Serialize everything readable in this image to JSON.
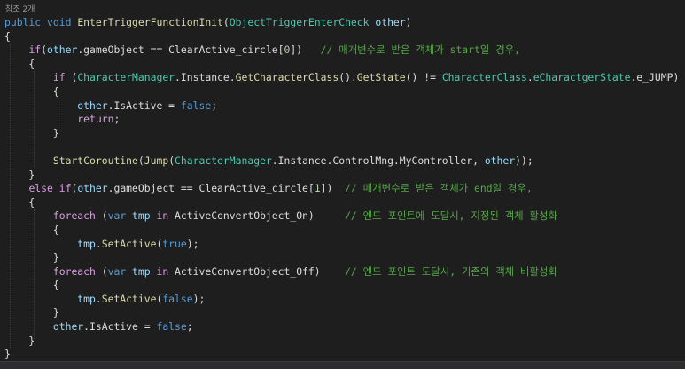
{
  "editor": {
    "reference_hint": "참조 2개",
    "colors": {
      "background": "#1e1e1e",
      "keyword": "#569cd6",
      "control": "#d8a0df",
      "type": "#4ec9b0",
      "method": "#dcdcaa",
      "variable": "#9cdcfe",
      "comment": "#57a64a",
      "number": "#b5cea8",
      "plain": "#dcdcdc"
    }
  },
  "lines": [
    [
      [
        "kw",
        "public"
      ],
      [
        "pl",
        " "
      ],
      [
        "kw",
        "void"
      ],
      [
        "pl",
        " "
      ],
      [
        "fn",
        "EnterTriggerFunctionInit"
      ],
      [
        "pl",
        "("
      ],
      [
        "cls",
        "ObjectTriggerEnterCheck"
      ],
      [
        "pl",
        " "
      ],
      [
        "var",
        "other"
      ],
      [
        "pl",
        ")"
      ]
    ],
    [
      [
        "pl",
        "{"
      ]
    ],
    [
      [
        "pl",
        "    "
      ],
      [
        "ctl",
        "if"
      ],
      [
        "pl",
        "("
      ],
      [
        "var",
        "other"
      ],
      [
        "pl",
        ".gameObject == ClearActive_circle["
      ],
      [
        "num",
        "0"
      ],
      [
        "pl",
        "])   "
      ],
      [
        "cm",
        "// 매개변수로 받은 객체가 start일 경우,"
      ]
    ],
    [
      [
        "pl",
        "    {"
      ]
    ],
    [
      [
        "pl",
        "        "
      ],
      [
        "ctl",
        "if"
      ],
      [
        "pl",
        " ("
      ],
      [
        "cls",
        "CharacterManager"
      ],
      [
        "pl",
        ".Instance."
      ],
      [
        "fn",
        "GetCharacterClass"
      ],
      [
        "pl",
        "()."
      ],
      [
        "fn",
        "GetState"
      ],
      [
        "pl",
        "() != "
      ],
      [
        "cls",
        "CharacterClass"
      ],
      [
        "pl",
        "."
      ],
      [
        "cls",
        "eCharactgerState"
      ],
      [
        "pl",
        ".e_JUMP)"
      ]
    ],
    [
      [
        "pl",
        "        {"
      ]
    ],
    [
      [
        "pl",
        "            "
      ],
      [
        "var",
        "other"
      ],
      [
        "pl",
        ".IsActive = "
      ],
      [
        "kw",
        "false"
      ],
      [
        "pl",
        ";"
      ]
    ],
    [
      [
        "pl",
        "            "
      ],
      [
        "ctl",
        "return"
      ],
      [
        "pl",
        ";"
      ]
    ],
    [
      [
        "pl",
        "        }"
      ]
    ],
    [
      [
        "pl",
        ""
      ]
    ],
    [
      [
        "pl",
        "        "
      ],
      [
        "fn",
        "StartCoroutine"
      ],
      [
        "pl",
        "("
      ],
      [
        "fn",
        "Jump"
      ],
      [
        "pl",
        "("
      ],
      [
        "cls",
        "CharacterManager"
      ],
      [
        "pl",
        ".Instance.ControlMng.MyController, "
      ],
      [
        "var",
        "other"
      ],
      [
        "pl",
        "));"
      ]
    ],
    [
      [
        "pl",
        "    }"
      ]
    ],
    [
      [
        "pl",
        "    "
      ],
      [
        "ctl",
        "else"
      ],
      [
        "pl",
        " "
      ],
      [
        "ctl",
        "if"
      ],
      [
        "pl",
        "("
      ],
      [
        "var",
        "other"
      ],
      [
        "pl",
        ".gameObject == ClearActive_circle["
      ],
      [
        "num",
        "1"
      ],
      [
        "pl",
        "])  "
      ],
      [
        "cm",
        "// 매개변수로 받은 객체가 end일 경우,"
      ]
    ],
    [
      [
        "pl",
        "    {"
      ]
    ],
    [
      [
        "pl",
        "        "
      ],
      [
        "ctl",
        "foreach"
      ],
      [
        "pl",
        " ("
      ],
      [
        "kw",
        "var"
      ],
      [
        "pl",
        " "
      ],
      [
        "var",
        "tmp"
      ],
      [
        "pl",
        " "
      ],
      [
        "ctl",
        "in"
      ],
      [
        "pl",
        " ActiveConvertObject_On)     "
      ],
      [
        "cm",
        "// 엔드 포인트에 도달시, 지정된 객체 활성화"
      ]
    ],
    [
      [
        "pl",
        "        {"
      ]
    ],
    [
      [
        "pl",
        "            "
      ],
      [
        "var",
        "tmp"
      ],
      [
        "pl",
        "."
      ],
      [
        "fn",
        "SetActive"
      ],
      [
        "pl",
        "("
      ],
      [
        "kw",
        "true"
      ],
      [
        "pl",
        ");"
      ]
    ],
    [
      [
        "pl",
        "        }"
      ]
    ],
    [
      [
        "pl",
        "        "
      ],
      [
        "ctl",
        "foreach"
      ],
      [
        "pl",
        " ("
      ],
      [
        "kw",
        "var"
      ],
      [
        "pl",
        " "
      ],
      [
        "var",
        "tmp"
      ],
      [
        "pl",
        " "
      ],
      [
        "ctl",
        "in"
      ],
      [
        "pl",
        " ActiveConvertObject_Off)    "
      ],
      [
        "cm",
        "// 엔드 포인트 도달시, 기존의 객체 비활성화"
      ]
    ],
    [
      [
        "pl",
        "        {"
      ]
    ],
    [
      [
        "pl",
        "            "
      ],
      [
        "var",
        "tmp"
      ],
      [
        "pl",
        "."
      ],
      [
        "fn",
        "SetActive"
      ],
      [
        "pl",
        "("
      ],
      [
        "kw",
        "false"
      ],
      [
        "pl",
        ");"
      ]
    ],
    [
      [
        "pl",
        "        }"
      ]
    ],
    [
      [
        "pl",
        "        "
      ],
      [
        "var",
        "other"
      ],
      [
        "pl",
        ".IsActive = "
      ],
      [
        "kw",
        "false"
      ],
      [
        "pl",
        ";"
      ]
    ],
    [
      [
        "pl",
        "    }"
      ]
    ],
    [
      [
        "pl",
        "}"
      ]
    ]
  ]
}
